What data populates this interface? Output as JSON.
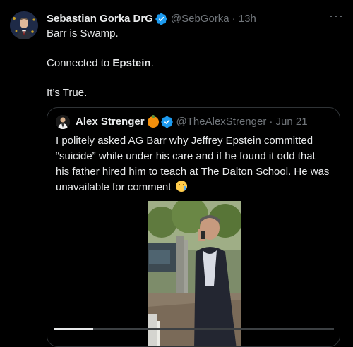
{
  "tweet": {
    "author_name": "Sebastian Gorka DrG",
    "author_handle": "@SebGorka",
    "time": "· 13h",
    "more_label": "···",
    "line1": "Barr is Swamp.",
    "line2_prefix": "Connected to ",
    "line2_bold": "Epstein",
    "line2_suffix": ".",
    "line3": "It’s True."
  },
  "quote": {
    "author_name": "Alex Strenger",
    "author_handle": "@TheAlexStrenger",
    "time": "· Jun 21",
    "text": "I politely asked AG Barr why Jeffrey Epstein committed “suicide” while under his care and if he found it odd that his father hired him to teach at The Dalton School. He was unavailable for comment",
    "video_progress": 0.14
  },
  "colors": {
    "background": "#000000",
    "text": "#e7e9ea",
    "secondary": "#71767b",
    "verified": "#1d9bf0",
    "border": "#2f3336"
  },
  "icons": {
    "verified": "verified-badge-icon",
    "more": "more-horizontal-icon",
    "emoji": "crying-face-emoji-icon",
    "orange": "orange-emoji-icon"
  }
}
